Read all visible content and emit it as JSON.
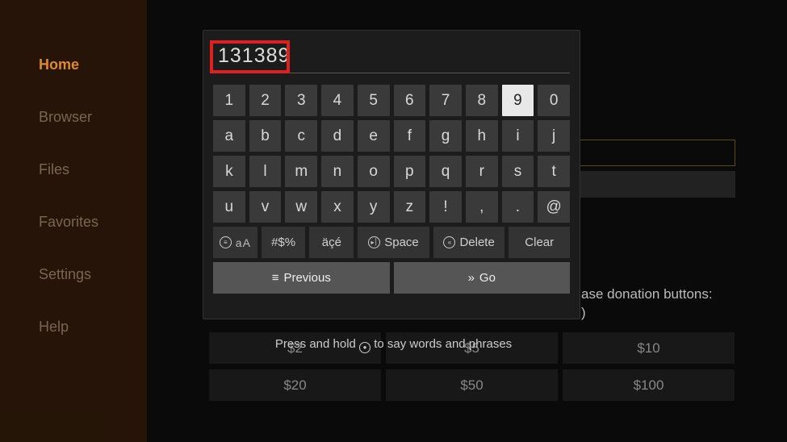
{
  "sidebar": {
    "items": [
      {
        "label": "Home",
        "active": true
      },
      {
        "label": "Browser",
        "active": false
      },
      {
        "label": "Files",
        "active": false
      },
      {
        "label": "Favorites",
        "active": false
      },
      {
        "label": "Settings",
        "active": false
      },
      {
        "label": "Help",
        "active": false
      }
    ]
  },
  "background": {
    "donation_text_frag1": "ase donation buttons:",
    "donation_text_frag2": ")",
    "amounts_row1": [
      "$2",
      "$5",
      "$10"
    ],
    "amounts_row2": [
      "$20",
      "$50",
      "$100"
    ]
  },
  "keyboard": {
    "display_value": "131389",
    "rows": [
      [
        "1",
        "2",
        "3",
        "4",
        "5",
        "6",
        "7",
        "8",
        "9",
        "0"
      ],
      [
        "a",
        "b",
        "c",
        "d",
        "e",
        "f",
        "g",
        "h",
        "i",
        "j"
      ],
      [
        "k",
        "l",
        "m",
        "n",
        "o",
        "p",
        "q",
        "r",
        "s",
        "t"
      ],
      [
        "u",
        "v",
        "w",
        "x",
        "y",
        "z",
        "!",
        ",",
        ".",
        "@"
      ]
    ],
    "selected_key": "9",
    "func": {
      "case": "aA",
      "symbols": "#$%",
      "accents": "äçé",
      "space": "Space",
      "delete": "Delete",
      "clear": "Clear"
    },
    "nav": {
      "previous": "Previous",
      "go": "Go"
    }
  },
  "hint": {
    "before": "Press and hold ",
    "after": " to say words and phrases"
  }
}
